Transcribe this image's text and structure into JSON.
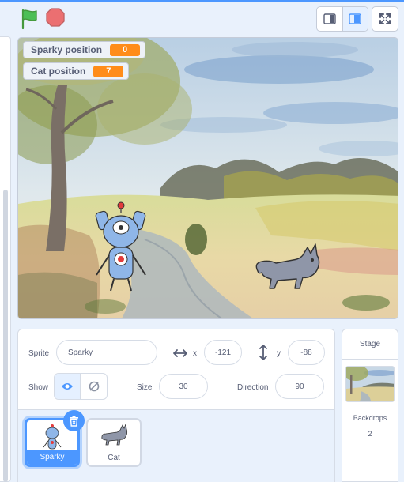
{
  "monitors": [
    {
      "label": "Sparky position",
      "value": "0"
    },
    {
      "label": "Cat position",
      "value": "7"
    }
  ],
  "sprite_info": {
    "sprite_label": "Sprite",
    "sprite_name": "Sparky",
    "x_label": "x",
    "x_value": "-121",
    "y_label": "y",
    "y_value": "-88",
    "show_label": "Show",
    "size_label": "Size",
    "size_value": "30",
    "direction_label": "Direction",
    "direction_value": "90"
  },
  "sprites": [
    {
      "name": "Sparky",
      "selected": true
    },
    {
      "name": "Cat",
      "selected": false
    }
  ],
  "stage_panel": {
    "title": "Stage",
    "backdrops_label": "Backdrops",
    "backdrops_count": "2"
  },
  "colors": {
    "accent": "#4c97ff",
    "monitor_value": "#ff8c1a",
    "flag": "#4cbf56",
    "stop": "#ec5959",
    "panel_bg": "#e9f1fc"
  },
  "icons": {
    "flag": "green-flag-icon",
    "stop": "stop-icon",
    "small_stage": "small-stage-icon",
    "normal_stage": "normal-stage-icon",
    "fullscreen": "fullscreen-icon",
    "show": "eye-icon",
    "hide": "eye-hidden-icon",
    "delete": "trash-icon"
  }
}
